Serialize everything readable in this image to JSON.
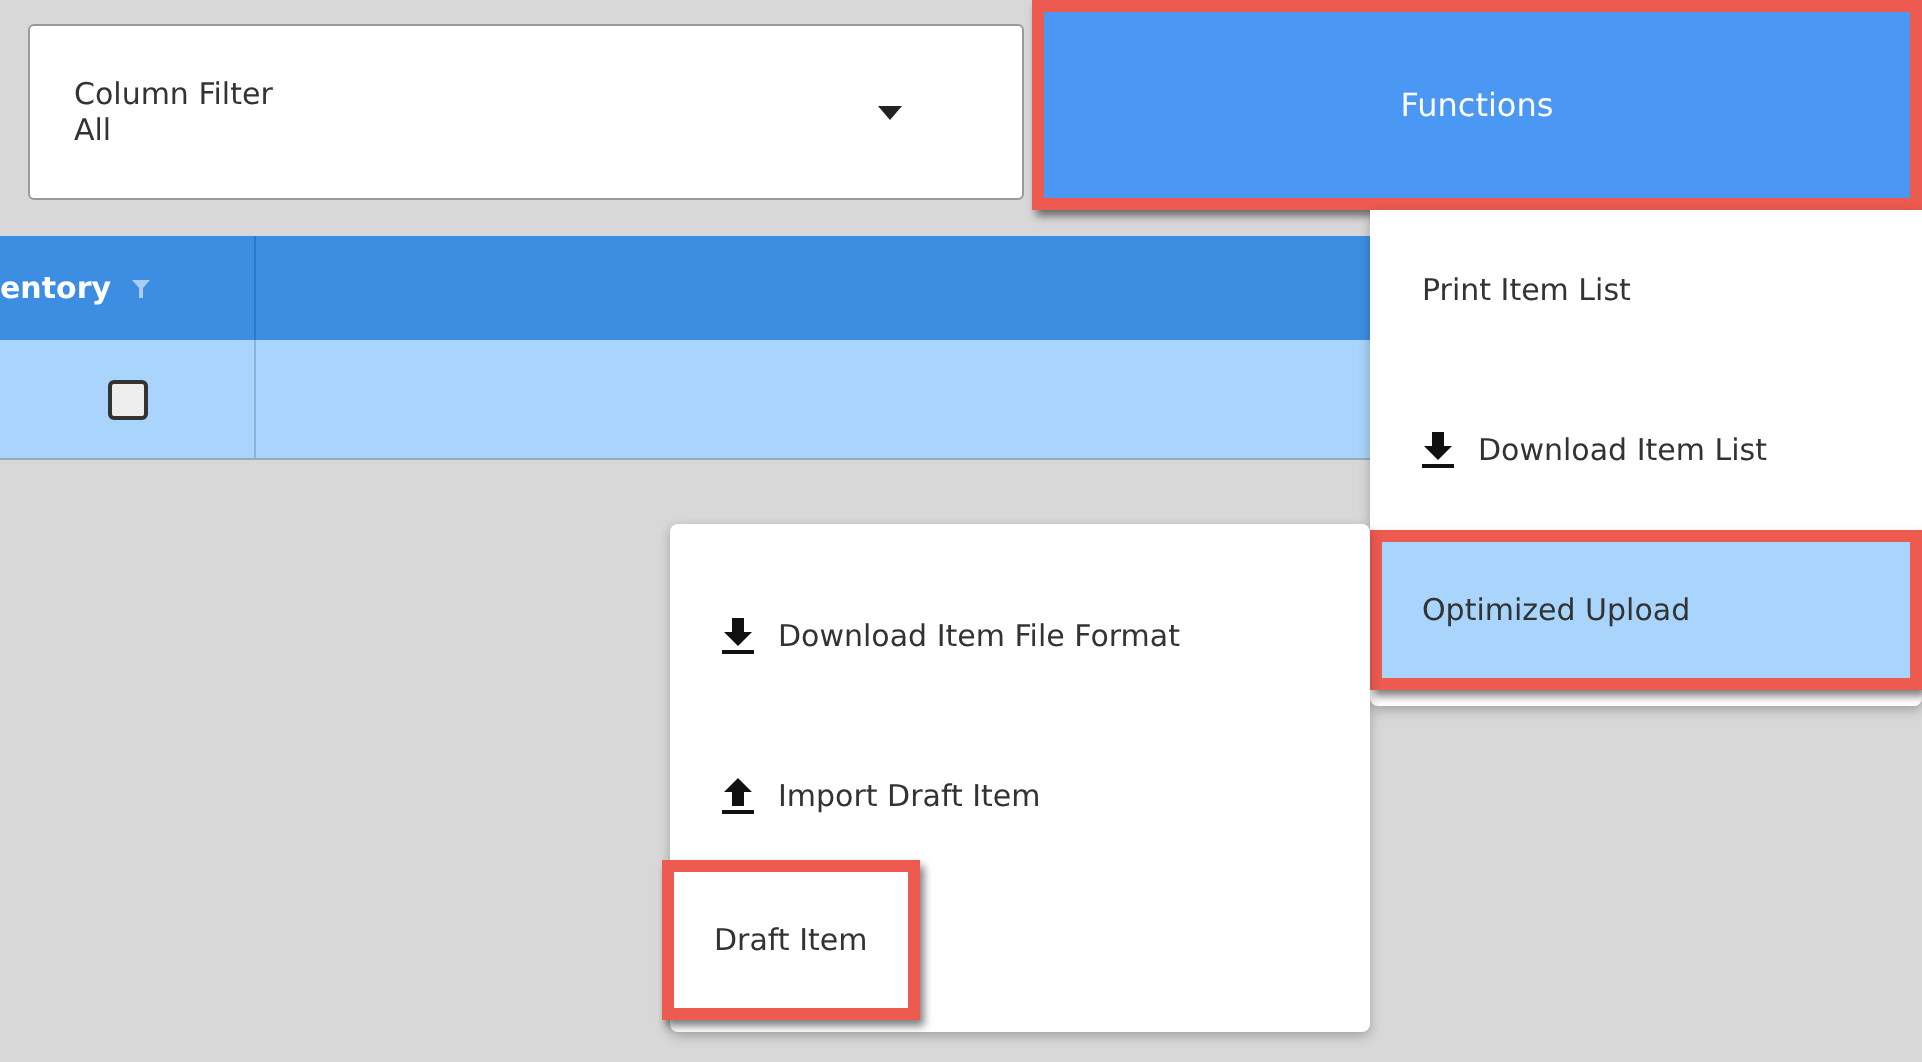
{
  "column_filter": {
    "label": "Column Filter",
    "value": "All"
  },
  "functions_button": {
    "label": "Functions",
    "highlighted": true
  },
  "table": {
    "columns": [
      {
        "label": "entory",
        "filter": true
      }
    ],
    "rows": [
      {
        "checked": false,
        "selected": true
      }
    ]
  },
  "functions_menu": [
    {
      "label": "Print Item List",
      "kind": "plain",
      "selected": false,
      "highlighted": false
    },
    {
      "label": "Download Item List",
      "kind": "download",
      "selected": false,
      "highlighted": false
    },
    {
      "label": "Optimized Upload",
      "kind": "plain",
      "selected": true,
      "highlighted": true
    }
  ],
  "upload_menu": [
    {
      "label": "Download Item File Format",
      "kind": "download",
      "selected": false,
      "highlighted": false
    },
    {
      "label": "Import Draft Item",
      "kind": "upload",
      "selected": false,
      "highlighted": false
    },
    {
      "label": "Draft Item",
      "kind": "plain",
      "selected": false,
      "highlighted": true
    }
  ]
}
